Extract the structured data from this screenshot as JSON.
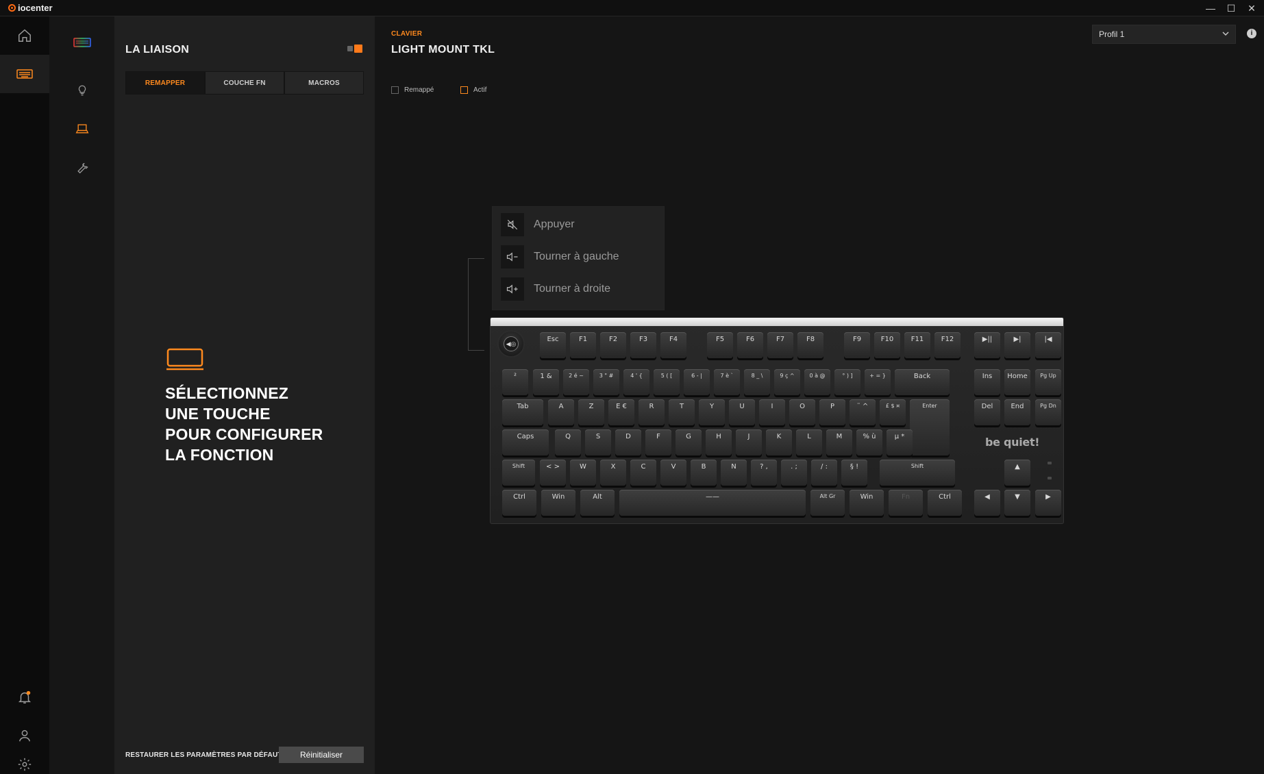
{
  "app": {
    "title": "iocenter"
  },
  "window": {
    "minimize": "—",
    "maximize": "☐",
    "close": "✕"
  },
  "rail": {
    "items": [
      {
        "icon": "home-icon"
      },
      {
        "icon": "keyboard-icon",
        "active": true
      },
      {
        "icon": "bell-icon"
      },
      {
        "icon": "user-icon"
      },
      {
        "icon": "gear-icon"
      }
    ]
  },
  "sub_nav": {
    "items": [
      {
        "icon": "rgb-keyboard-icon"
      },
      {
        "icon": "lightbulb-icon"
      },
      {
        "icon": "laptop-icon",
        "active": true
      },
      {
        "icon": "wrench-icon"
      }
    ]
  },
  "panel": {
    "title": "LA LIAISON",
    "tabs": [
      {
        "label": "REMAPPER",
        "active": true
      },
      {
        "label": "COUCHE FN"
      },
      {
        "label": "MACROS"
      }
    ],
    "prompt": [
      "SÉLECTIONNEZ",
      "UNE TOUCHE",
      "POUR CONFIGURER",
      "LA FONCTION"
    ],
    "restore_label": "RESTAURER LES PARAMÈTRES PAR DÉFAUT",
    "reset_button": "Réinitialiser"
  },
  "main": {
    "crumb": "CLAVIER",
    "device": "LIGHT MOUNT TKL",
    "legend": {
      "remapped": "Remappé",
      "active": "Actif"
    },
    "profile": {
      "selected": "Profil 1"
    },
    "info": "i"
  },
  "knob_menu": {
    "items": [
      {
        "label": "Appuyer",
        "icon": "mute-icon"
      },
      {
        "label": "Tourner à gauche",
        "icon": "volume-down-icon"
      },
      {
        "label": "Tourner à droite",
        "icon": "volume-up-icon"
      }
    ]
  },
  "keyboard": {
    "brand": "be quiet!",
    "knob_label": "◀◎",
    "accent": "#ff8a1e",
    "rows": [
      [
        {
          "l": "Esc"
        },
        {
          "l": "F1"
        },
        {
          "l": "F2"
        },
        {
          "l": "F3"
        },
        {
          "l": "F4"
        },
        {
          "l": "F5"
        },
        {
          "l": "F6"
        },
        {
          "l": "F7"
        },
        {
          "l": "F8"
        },
        {
          "l": "F9"
        },
        {
          "l": "F10"
        },
        {
          "l": "F11"
        },
        {
          "l": "F12"
        },
        {
          "l": "▶||"
        },
        {
          "l": "▶|"
        },
        {
          "l": "|◀"
        }
      ],
      [
        {
          "l": "²"
        },
        {
          "l": "1 &"
        },
        {
          "l": "2 é ~"
        },
        {
          "l": "3 \" #"
        },
        {
          "l": "4 ' {"
        },
        {
          "l": "5 ( ["
        },
        {
          "l": "6 - |"
        },
        {
          "l": "7 è `"
        },
        {
          "l": "8 _ \\"
        },
        {
          "l": "9 ç ^"
        },
        {
          "l": "0 à @"
        },
        {
          "l": "° ) ]"
        },
        {
          "l": "+ = }"
        },
        {
          "l": "Back"
        },
        {
          "l": "Ins"
        },
        {
          "l": "Home"
        },
        {
          "l": "Pg Up"
        }
      ],
      [
        {
          "l": "Tab"
        },
        {
          "l": "A"
        },
        {
          "l": "Z"
        },
        {
          "l": "E €"
        },
        {
          "l": "R"
        },
        {
          "l": "T"
        },
        {
          "l": "Y"
        },
        {
          "l": "U"
        },
        {
          "l": "I"
        },
        {
          "l": "O"
        },
        {
          "l": "P"
        },
        {
          "l": "¨ ^"
        },
        {
          "l": "£ $ ¤"
        },
        {
          "l": "Enter"
        },
        {
          "l": "Del"
        },
        {
          "l": "End"
        },
        {
          "l": "Pg Dn"
        }
      ],
      [
        {
          "l": "Caps"
        },
        {
          "l": "Q"
        },
        {
          "l": "S"
        },
        {
          "l": "D"
        },
        {
          "l": "F"
        },
        {
          "l": "G"
        },
        {
          "l": "H"
        },
        {
          "l": "J"
        },
        {
          "l": "K"
        },
        {
          "l": "L"
        },
        {
          "l": "M"
        },
        {
          "l": "% ù"
        },
        {
          "l": "µ *"
        }
      ],
      [
        {
          "l": "Shift"
        },
        {
          "l": "< >"
        },
        {
          "l": "W"
        },
        {
          "l": "X"
        },
        {
          "l": "C"
        },
        {
          "l": "V"
        },
        {
          "l": "B"
        },
        {
          "l": "N"
        },
        {
          "l": "? ,"
        },
        {
          "l": ". ;"
        },
        {
          "l": "/ :"
        },
        {
          "l": "§ !"
        },
        {
          "l": "Shift"
        },
        {
          "l": "▲"
        }
      ],
      [
        {
          "l": "Ctrl"
        },
        {
          "l": "Win"
        },
        {
          "l": "Alt"
        },
        {
          "l": "——"
        },
        {
          "l": "Alt Gr"
        },
        {
          "l": "Win"
        },
        {
          "l": "Fn"
        },
        {
          "l": "Ctrl"
        },
        {
          "l": "◀"
        },
        {
          "l": "▼"
        },
        {
          "l": "▶"
        }
      ]
    ]
  }
}
